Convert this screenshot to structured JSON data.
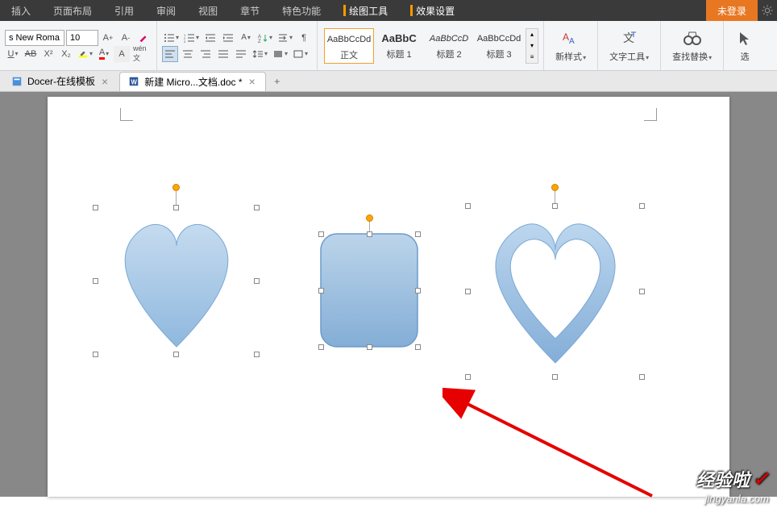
{
  "menu": {
    "items": [
      "插入",
      "页面布局",
      "引用",
      "审阅",
      "视图",
      "章节",
      "特色功能"
    ],
    "tool_tabs": [
      "绘图工具",
      "效果设置"
    ],
    "login": "未登录"
  },
  "ribbon": {
    "font_name": "s New Roma",
    "font_size": "10",
    "styles": [
      {
        "preview": "AaBbCcDd",
        "name": "正文"
      },
      {
        "preview": "AaBbC",
        "name": "标题 1"
      },
      {
        "preview": "AaBbCcD",
        "name": "标题 2"
      },
      {
        "preview": "AaBbCcDd",
        "name": "标题 3"
      }
    ],
    "new_style": "新样式",
    "text_tools": "文字工具",
    "find_replace": "查找替换",
    "select": "选"
  },
  "tabs": {
    "items": [
      {
        "label": "Docer-在线模板",
        "active": false
      },
      {
        "label": "新建 Micro...文档.doc *",
        "active": true
      }
    ]
  },
  "watermark": {
    "text": "经验啦",
    "url": "jingyanla.com"
  }
}
